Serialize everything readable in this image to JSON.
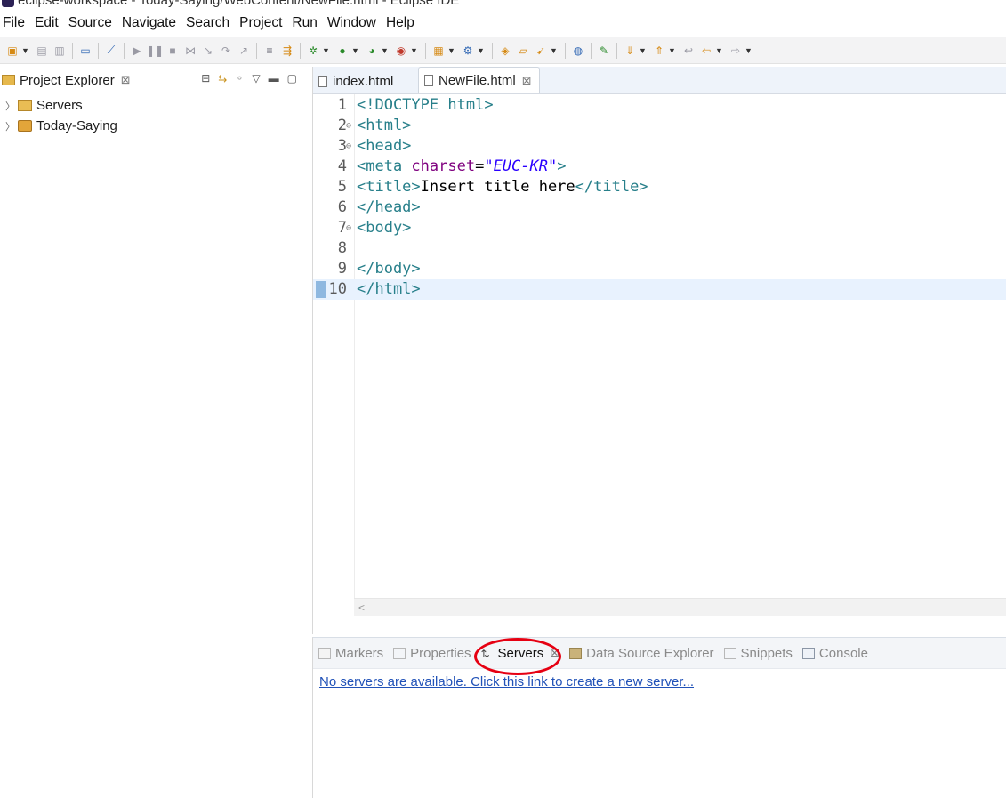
{
  "window": {
    "title": "eclipse-workspace - Today-Saying/WebContent/NewFile.html - Eclipse IDE"
  },
  "menu": [
    "File",
    "Edit",
    "Source",
    "Navigate",
    "Search",
    "Project",
    "Run",
    "Window",
    "Help"
  ],
  "project_explorer": {
    "title": "Project Explorer",
    "items": [
      {
        "label": "Servers",
        "icon": "folder-icon"
      },
      {
        "label": "Today-Saying",
        "icon": "web-project-icon"
      }
    ]
  },
  "editor": {
    "tabs": [
      {
        "label": "index.html",
        "active": false
      },
      {
        "label": "NewFile.html",
        "active": true
      }
    ],
    "lines": [
      {
        "num": "1",
        "fold": "",
        "segments": [
          [
            "tag",
            "<!DOCTYPE "
          ],
          [
            "tag",
            "html"
          ],
          [
            "tag",
            ">"
          ]
        ]
      },
      {
        "num": "2",
        "fold": "⊖",
        "segments": [
          [
            "tag",
            "<html>"
          ]
        ]
      },
      {
        "num": "3",
        "fold": "⊖",
        "segments": [
          [
            "tag",
            "<head>"
          ]
        ]
      },
      {
        "num": "4",
        "fold": "",
        "segments": [
          [
            "tag",
            "<meta "
          ],
          [
            "attr",
            "charset"
          ],
          [
            "txt",
            "="
          ],
          [
            "val",
            "\"EUC-KR\""
          ],
          [
            "tag",
            ">"
          ]
        ]
      },
      {
        "num": "5",
        "fold": "",
        "segments": [
          [
            "tag",
            "<title>"
          ],
          [
            "txt",
            "Insert title here"
          ],
          [
            "tag",
            "</title>"
          ]
        ]
      },
      {
        "num": "6",
        "fold": "",
        "segments": [
          [
            "tag",
            "</head>"
          ]
        ]
      },
      {
        "num": "7",
        "fold": "⊖",
        "segments": [
          [
            "tag",
            "<body>"
          ]
        ]
      },
      {
        "num": "8",
        "fold": "",
        "segments": []
      },
      {
        "num": "9",
        "fold": "",
        "segments": [
          [
            "tag",
            "</body>"
          ]
        ]
      },
      {
        "num": "10",
        "fold": "",
        "segments": [
          [
            "tag",
            "</html>"
          ]
        ],
        "current": true
      }
    ],
    "hscroll_arrow": "<"
  },
  "bottom_panel": {
    "tabs": [
      {
        "label": "Markers",
        "icon": "markers-icon",
        "active": false
      },
      {
        "label": "Properties",
        "icon": "properties-icon",
        "active": false
      },
      {
        "label": "Servers",
        "icon": "servers-icon",
        "active": true
      },
      {
        "label": "Data Source Explorer",
        "icon": "data-source-icon",
        "active": false
      },
      {
        "label": "Snippets",
        "icon": "snippets-icon",
        "active": false
      },
      {
        "label": "Console",
        "icon": "console-icon",
        "active": false
      }
    ],
    "servers_link": "No servers are available. Click this link to create a new server..."
  },
  "colors": {
    "tag": "#277f8a",
    "attr": "#7f007f",
    "value": "#2a00ff",
    "highlight_ring": "#e60012",
    "link": "#2152b8"
  }
}
